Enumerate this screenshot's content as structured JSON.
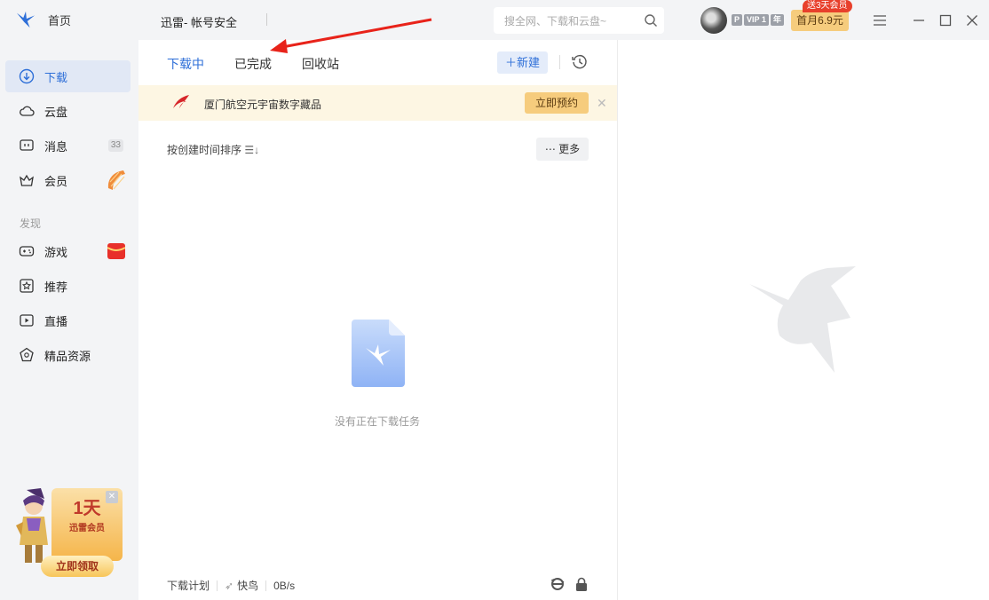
{
  "sidebar": {
    "home_label": "首页",
    "items": [
      {
        "label": "下载",
        "icon": "download-icon"
      },
      {
        "label": "云盘",
        "icon": "cloud-icon"
      },
      {
        "label": "消息",
        "icon": "message-icon",
        "badge": "33"
      },
      {
        "label": "会员",
        "icon": "crown-icon"
      },
      {
        "label": "游戏",
        "icon": "gamepad-icon"
      },
      {
        "label": "推荐",
        "icon": "star-icon"
      },
      {
        "label": "直播",
        "icon": "live-icon"
      },
      {
        "label": "精品资源",
        "icon": "gem-icon"
      }
    ],
    "section_discover": "发现",
    "promo": {
      "day": "1天",
      "vip": "迅雷会员",
      "button": "立即领取"
    }
  },
  "titlebar": {
    "title": "迅雷- 帐号安全",
    "search_placeholder": "搜全网、下载和云盘~",
    "vip_p": "P",
    "vip_level": "VIP 1",
    "vip_year": "年",
    "gift_badge": "送3天会员",
    "price_button": "首月6.9元"
  },
  "tabs": [
    {
      "label": "下载中",
      "active": true
    },
    {
      "label": "已完成",
      "active": false
    },
    {
      "label": "回收站",
      "active": false
    }
  ],
  "toolbar": {
    "new_label": "新建"
  },
  "banner": {
    "text": "厦门航空元宇宙数字藏品",
    "button": "立即预约"
  },
  "list": {
    "sort_label": "按创建时间排序",
    "more_label": "更多",
    "empty_text": "没有正在下载任务"
  },
  "footer": {
    "plan": "下载计划",
    "mode": "快鸟",
    "speed": "0B/s"
  },
  "colors": {
    "accent": "#2e6fd8",
    "sidebar_bg": "#f3f4f6",
    "gold": "#f6cc7d",
    "arrow": "#e8231a"
  }
}
